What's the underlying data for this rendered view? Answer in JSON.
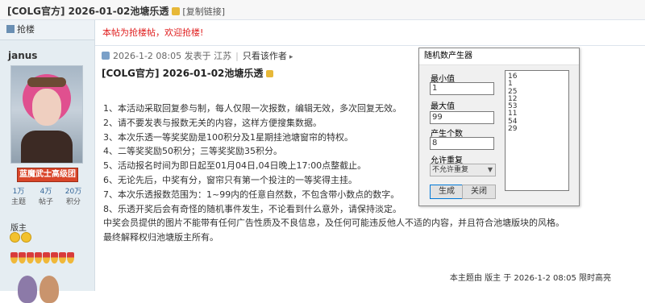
{
  "thread": {
    "title": "[COLG官方] 2026-01-02池塘乐透",
    "copy_link": "[复制链接]"
  },
  "sidebar": {
    "grab_label": "抢楼",
    "username": "janus",
    "rank_badge": "蓝魔武士高级团",
    "stats": [
      {
        "value": "1万",
        "label": "主题"
      },
      {
        "value": "4万",
        "label": "帖子"
      },
      {
        "value": "20万",
        "label": "积分"
      }
    ],
    "moderator": "版主"
  },
  "post": {
    "notice": "本帖为抢楼帖，欢迎抢楼!",
    "meta_date": "2026-1-2 08:05 发表于 江苏",
    "meta_only_author": "只看该作者",
    "title": "[COLG官方] 2026-01-02池塘乐透",
    "lines": [
      "1、本活动采取回复参与制，每人仅限一次报数，编辑无效，多次回复无效。",
      "2、请不要发表与报数无关的内容，这样方便搜集数据。",
      "3、本次乐透一等奖奖励是100积分及1星期挂池塘窗帘的特权。",
      "4、二等奖奖励50积分；三等奖奖励35积分。",
      "5、活动报名时间为即日起至01月04日,04日晚上17:00点整截止。",
      "6、无论先后，中奖有分，窗帘只有第一个投注的一等奖得主挂。",
      "7、本次乐透报数范围为：1~99内的任意自然数，不包含带小数点的数字。",
      "8、乐透开奖后会有奇怪的随机事件发生，不论看到什么意外，请保持淡定。",
      "中奖会员提供的图片不能带有任何广告性质及不良信息，及任何可能违反他人不适的内容，并且符合池塘版块的风格。",
      "最终解释权归池塘版主所有。"
    ],
    "footer": "本主题由 版主 于 2026-1-2 08:05 限时高亮"
  },
  "dialog": {
    "title": "随机数产生器",
    "min_label": "最小值",
    "min_value": "1",
    "max_label": "最大值",
    "max_value": "99",
    "count_label": "产生个数",
    "count_value": "8",
    "allow_repeat_label": "允许重复",
    "allow_repeat_value": "不允许重复",
    "generate_button": "生成",
    "close_button": "关闭",
    "results": [
      "16",
      "1",
      "25",
      "12",
      "53",
      "11",
      "54",
      "29"
    ]
  },
  "colors": {
    "notice": "#e01f1f",
    "rank_badge": "#d9462a",
    "sidebar_bg": "#e5edf2"
  }
}
